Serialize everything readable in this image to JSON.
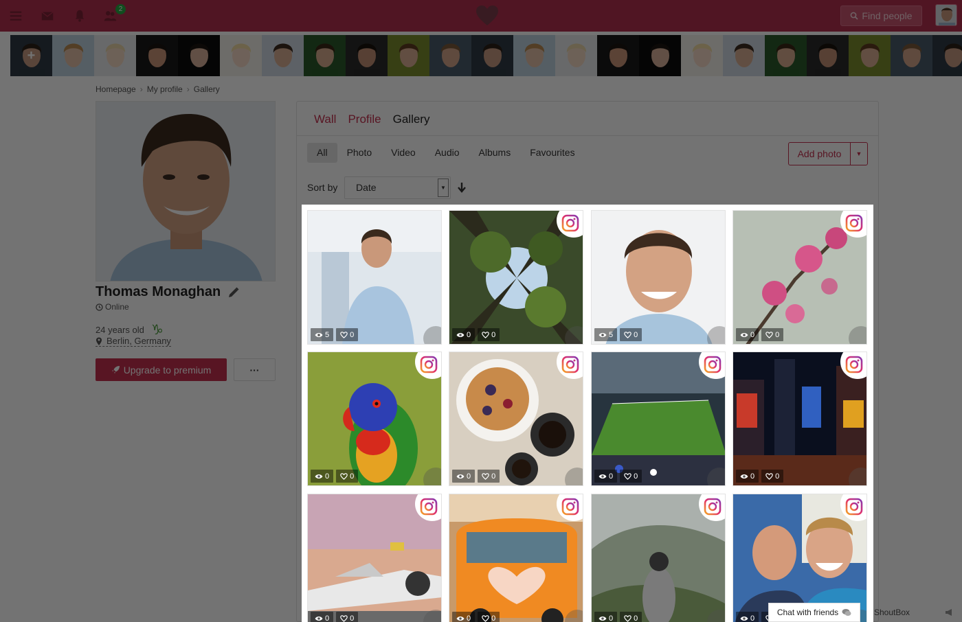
{
  "topbar": {
    "friends_badge": "2",
    "find_people_label": "Find people"
  },
  "breadcrumb": [
    "Homepage",
    "My profile",
    "Gallery"
  ],
  "profile": {
    "name": "Thomas Monaghan",
    "status": "Online",
    "age": "24 years old",
    "zodiac": "♑",
    "location": "Berlin, Germany",
    "upgrade_label": "Upgrade to premium",
    "more_label": "···"
  },
  "tabs": [
    {
      "label": "Wall",
      "active": false
    },
    {
      "label": "Profile",
      "active": false
    },
    {
      "label": "Gallery",
      "active": true
    }
  ],
  "filters": [
    {
      "label": "All",
      "active": true
    },
    {
      "label": "Photo",
      "active": false
    },
    {
      "label": "Video",
      "active": false
    },
    {
      "label": "Audio",
      "active": false
    },
    {
      "label": "Albums",
      "active": false
    },
    {
      "label": "Favourites",
      "active": false
    }
  ],
  "add_photo_label": "Add photo",
  "sort": {
    "label": "Sort by",
    "value": "Date"
  },
  "gallery": [
    {
      "subject": "man-office",
      "views": "5",
      "likes": "0",
      "instagram": false
    },
    {
      "subject": "forest-canopy",
      "views": "0",
      "likes": "0",
      "instagram": true
    },
    {
      "subject": "man-portrait",
      "views": "5",
      "likes": "0",
      "instagram": false
    },
    {
      "subject": "cherry-blossom",
      "views": "0",
      "likes": "0",
      "instagram": true
    },
    {
      "subject": "parrot",
      "views": "0",
      "likes": "0",
      "instagram": true
    },
    {
      "subject": "pie-coffee",
      "views": "0",
      "likes": "0",
      "instagram": true
    },
    {
      "subject": "stadium",
      "views": "0",
      "likes": "0",
      "instagram": true
    },
    {
      "subject": "city-night",
      "views": "0",
      "likes": "0",
      "instagram": true
    },
    {
      "subject": "airplane",
      "views": "0",
      "likes": "0",
      "instagram": true
    },
    {
      "subject": "orange-van",
      "views": "0",
      "likes": "0",
      "instagram": true
    },
    {
      "subject": "hiker-mountain",
      "views": "0",
      "likes": "0",
      "instagram": true
    },
    {
      "subject": "two-men",
      "views": "0",
      "likes": "0",
      "instagram": true
    }
  ],
  "footer": {
    "chat_label": "Chat with friends",
    "shoutbox_label": "ShoutBox"
  },
  "colors": {
    "brand": "#b2304e",
    "accent": "#c4304e"
  }
}
